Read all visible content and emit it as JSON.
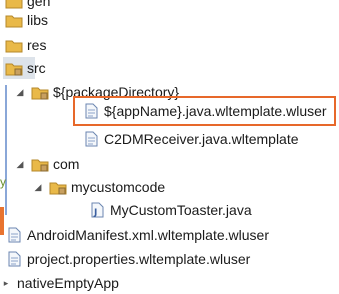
{
  "tree": {
    "items": [
      {
        "label": "gen",
        "icon": "folder-icon"
      },
      {
        "label": "libs",
        "icon": "folder-icon"
      },
      {
        "label": "res",
        "icon": "folder-icon"
      },
      {
        "label": "src",
        "icon": "package-folder-icon"
      },
      {
        "label": "${packageDirectory}",
        "icon": "folder-icon",
        "expanded": true
      },
      {
        "label": "${appName}.java.wltemplate.wluser",
        "icon": "file-icon"
      },
      {
        "label": "C2DMReceiver.java.wltemplate",
        "icon": "file-icon"
      },
      {
        "label": "com",
        "icon": "folder-icon",
        "expanded": true
      },
      {
        "label": "mycustomcode",
        "icon": "folder-icon",
        "expanded": true
      },
      {
        "label": "MyCustomToaster.java",
        "icon": "java-file-icon"
      },
      {
        "label": "AndroidManifest.xml.wltemplate.wluser",
        "icon": "file-icon"
      },
      {
        "label": "project.properties.wltemplate.wluser",
        "icon": "file-icon"
      },
      {
        "label": "nativeEmptyApp",
        "icon": "folder-icon"
      }
    ]
  },
  "side_fragment": "y",
  "colors": {
    "highlight_border": "#e7682a",
    "folder": "#e9b949",
    "selection": "#dde3ea"
  }
}
